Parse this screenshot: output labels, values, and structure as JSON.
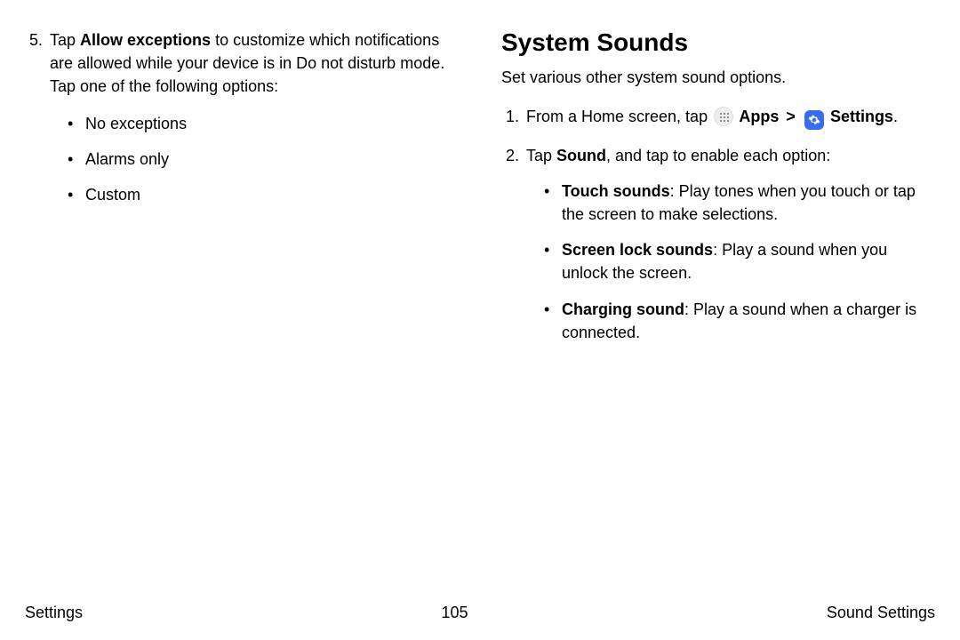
{
  "left": {
    "step_num": "5.",
    "step_pre": "Tap ",
    "step_bold": "Allow exceptions",
    "step_post": " to customize which notifications are allowed while your device is in Do not disturb mode. Tap one of the following options:",
    "bullets": [
      "No exceptions",
      "Alarms only",
      "Custom"
    ]
  },
  "right": {
    "heading": "System Sounds",
    "intro": "Set various other system sound options.",
    "step1_num": "1.",
    "step1_pre": "From a Home screen, tap ",
    "step1_apps": " Apps",
    "step1_chev": " > ",
    "step1_settings": " Settings",
    "step1_end": ".",
    "step2_num": "2.",
    "step2_a": "Tap ",
    "step2_b": "Sound",
    "step2_c": ", and tap to enable each option:",
    "bullets": [
      {
        "bold": "Touch sounds",
        "rest": ": Play tones when you touch or tap the screen to make selections."
      },
      {
        "bold": "Screen lock sounds",
        "rest": ": Play a sound when you unlock the screen."
      },
      {
        "bold": "Charging sound",
        "rest": ": Play a sound when a charger is connected."
      }
    ]
  },
  "footer": {
    "left": "Settings",
    "center": "105",
    "right": "Sound Settings"
  }
}
